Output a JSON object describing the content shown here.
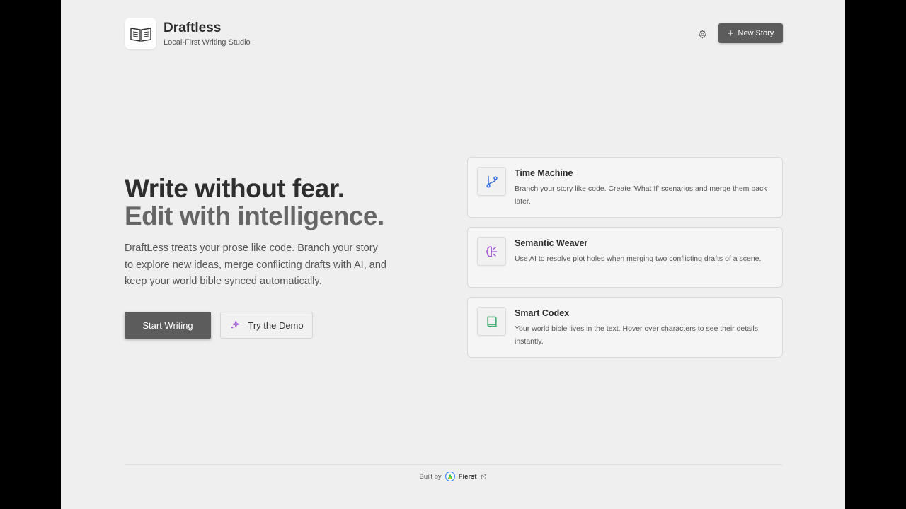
{
  "header": {
    "brand_name": "Draftless",
    "brand_tagline": "Local-First Writing Studio",
    "new_story_label": "New Story",
    "icons": {
      "logo": "open-book-icon",
      "settings": "gear-icon",
      "new_story": "plus-icon"
    }
  },
  "hero": {
    "headline_line1": "Write without fear.",
    "headline_line2": "Edit with intelligence.",
    "description": "DraftLess treats your prose like code. Branch your story to explore new ideas, merge conflicting drafts with AI, and keep your world bible synced automatically.",
    "start_label": "Start Writing",
    "demo_label": "Try the Demo"
  },
  "features": [
    {
      "title": "Time Machine",
      "description": "Branch your story like code. Create 'What If' scenarios and merge them back later.",
      "icon": "git-branch-icon",
      "icon_color": "#3b6fd8"
    },
    {
      "title": "Semantic Weaver",
      "description": "Use AI to resolve plot holes when merging two conflicting drafts of a scene.",
      "icon": "brain-icon",
      "icon_color": "#a04fd6"
    },
    {
      "title": "Smart Codex",
      "description": "Your world bible lives in the text. Hover over characters to see their details instantly.",
      "icon": "book-icon",
      "icon_color": "#3aa86a"
    }
  ],
  "footer": {
    "built_by": "Built by",
    "brand": "Fierst"
  },
  "colors": {
    "primary_button": "#5c5c5c",
    "page_background": "#efefef",
    "demo_icon": "#a04fd6"
  }
}
